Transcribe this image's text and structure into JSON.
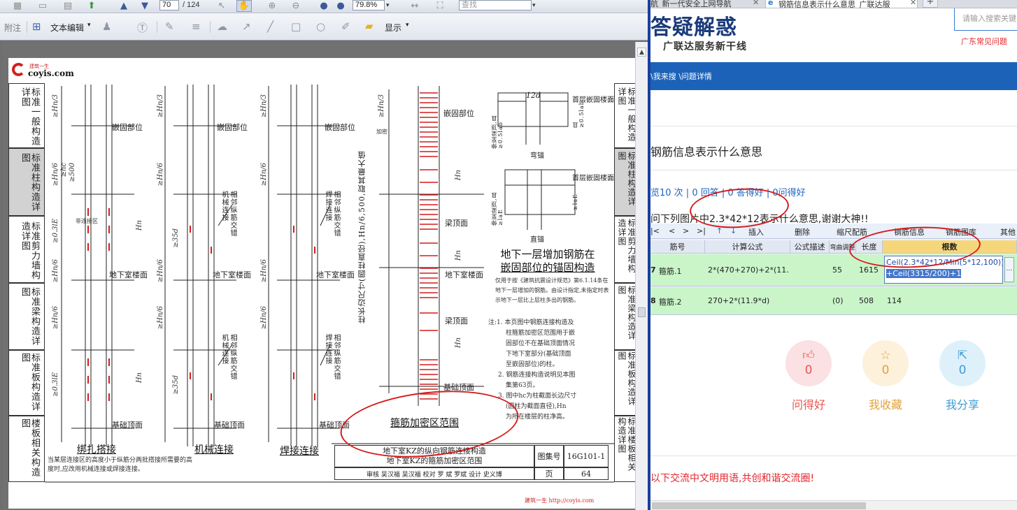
{
  "reader": {
    "toolbar1": {
      "page_current": "70",
      "page_total": "/ 124",
      "zoom": "79.8%",
      "search_placeholder": "查找"
    },
    "toolbar2": {
      "attach_label": "附注",
      "text_edit_label": "文本编辑",
      "show_label": "显示"
    },
    "page": {
      "logo_small": "建筑一生",
      "logo_url": "coyis.com",
      "left_sections": [
        "标准一般构造详图",
        "标准柱构造详图",
        "标准剪力墙构造详图",
        "标准梁构造详图",
        "标准板构造详图",
        "楼板相关构造图"
      ],
      "right_sections": [
        "标准一般构造详图",
        "标准柱构造详图",
        "标准剪力墙构造详图",
        "标准梁构造详图",
        "标准板构造详图",
        "标准楼板相关构造详图"
      ],
      "labels": {
        "embed1": "嵌固部位",
        "embed2": "嵌固部位",
        "embed3": "嵌固部位",
        "embed4": "嵌固部位",
        "basement_floor1": "地下室楼面",
        "basement_floor2": "地下室楼面",
        "basement_floor3": "地下室楼面",
        "basement_floor4": "地下室楼面",
        "base_top1": "基础顶面",
        "base_top2": "基础顶面",
        "base_top3": "基础顶面",
        "base_top4": "基础顶面",
        "beam_top1": "梁顶面",
        "beam_top2": "梁顶面",
        "mech_note1": "相邻纵筋交错机械连接",
        "mech_note2": "相邻纵筋交错机械连接",
        "weld_note1": "相邻纵筋交错焊接连接",
        "weld_note2": "相邻纵筋交错焊接连接",
        "col_size": "柱长边尺寸(圆柱直径),Hn/6,500,取其最大值",
        "top_floor1": "首层嵌固楼面",
        "top_floor2": "首层嵌固楼面",
        "bend": "弯锚",
        "straight": "直锚",
        "d12": "12d",
        "la05": "且≥0.5lab",
        "lae": "≥laE",
        "bend_side": "伸至梁顶,且≥0.5lab",
        "straight_side": "伸至梁顶,且≥laE"
      },
      "dims": {
        "hn3a": "≥Hn/3",
        "hn3b": "≥Hn/3",
        "hn3c": "≥Hn/3",
        "hn3d": "≥Hn/3",
        "hn6a": "≥Hn/6",
        "hn6b": "≥Hn/6",
        "hn6c": "≥Hn/6",
        "hn6d": "≥Hn/6",
        "hn6e": "≥Hn/6",
        "hn6f": "≥Hn/6",
        "hn6g": "≥Hn/6",
        "hn6h": "≥Hn/6",
        "hn6i": "≥Hn/6",
        "hc": "≥hc",
        "s500": "≥500",
        "l3a": "≥0.3lE",
        "l3b": "≥0.3lE",
        "d35a": "≥35d",
        "d35b": "≥35d",
        "hn_mid1": "Hn",
        "hn_mid2": "Hn",
        "hn_mid3": "Hn",
        "hn_mid4": "Hn",
        "hn_mid5": "Hn",
        "dense": "加密",
        "nondense": "非连接区"
      },
      "captions": {
        "tie": "绑扎搭接",
        "mech": "机械连接",
        "weld": "焊接连接",
        "stirrup_zone": "箍筋加密区范围",
        "bottom_note": "当某层连接区的高度小于纵筋分两批搭接所需要的高度时,应改用机械连接或焊接连接。"
      },
      "anchor_title_1": "地下一层增加钢筋在",
      "anchor_title_2": "嵌固部位的锚固构造",
      "anchor_desc": "仅用于按《建筑抗震设计规范》第6.1.14条在地下一层增加的钢筋。由设计指定,未指定时表示地下一层比上层柱多出的钢筋。",
      "notes": [
        "注:1. 本页图中钢筋连接构造及",
        "柱箍筋加密区范围用于嵌",
        "固部位不在基础顶面情况",
        "下地下室部分(基础顶面",
        "至嵌固部位)的柱。",
        "2. 钢筋连接构造说明见本图",
        "集第63页。",
        "3. 图中hc为柱截面长边尺寸",
        "(圆柱为截面直径),Hn",
        "为所在楼层的柱净高。"
      ],
      "title_block": {
        "line1": "地下室KZ的纵向钢筋连接构造",
        "line2": "地下室KZ的箍筋加密区范围",
        "atlas_label": "图集号",
        "atlas_no": "16G101-1",
        "page_label": "页",
        "page_no": "64",
        "sign_row": "审核 吴汉福 吴汉福 校对 罗 斌 罗斌 设计 史义博"
      },
      "footer_url": "建筑一生 http://coyis.com"
    }
  },
  "browser": {
    "tabs": [
      {
        "label": "航_新一代安全上网导航",
        "active": false
      },
      {
        "label": "钢筋信息表示什么意思_广联达服",
        "active": true
      }
    ],
    "site_title": "答疑解惑",
    "site_subtitle": "广联达服务新干线",
    "search_placeholder": "请输入搜索关键",
    "hot_link": "广东常见问题",
    "breadcrumb": "\\我来搜 \\问题详情",
    "question_title": "钢筋信息表示什么意思",
    "question_meta": "览10 次 | 0 回答 | 0 答得好 | 0问得好",
    "question_body": "问下列图片中2.3*42*12表示什么意思,谢谢大神!!",
    "grid": {
      "toolbar": [
        "|<",
        "<",
        ">",
        ">|",
        "↑",
        "↓",
        "插入",
        "删除",
        "缩尺配筋",
        "钢筋信息",
        "钢筋图库",
        "其他"
      ],
      "headers": [
        "筋号",
        "计算公式",
        "公式描述",
        "弯曲调整",
        "长度",
        "根数"
      ],
      "rows": [
        {
          "index": "7",
          "name": "箍筋.1",
          "formula": "2*(470+270)+2*(11…",
          "desc": "",
          "adjust": "55",
          "length": "1615",
          "count_line1": "Ceil(2.3*42*12/Min(5*12,100))",
          "count_line2": "+Ceil(3315/200)+1"
        },
        {
          "index": "8",
          "name": "箍筋.2",
          "formula": "270+2*(11.9*d)",
          "desc": "",
          "adjust": "(0)",
          "length": "508",
          "count": "114"
        }
      ]
    },
    "actions": [
      {
        "label": "问得好",
        "count": "0",
        "icon": "thumb-up-icon",
        "color": "#e8574f",
        "bg": "#fbe1e3"
      },
      {
        "label": "我收藏",
        "count": "0",
        "icon": "star-icon",
        "color": "#e0a23a",
        "bg": "#fdf1dc"
      },
      {
        "label": "我分享",
        "count": "0",
        "icon": "share-icon",
        "color": "#3f9bd7",
        "bg": "#def1fb"
      }
    ],
    "footer_notice": "以下交流中文明用语,共创和谐交流圈!"
  }
}
